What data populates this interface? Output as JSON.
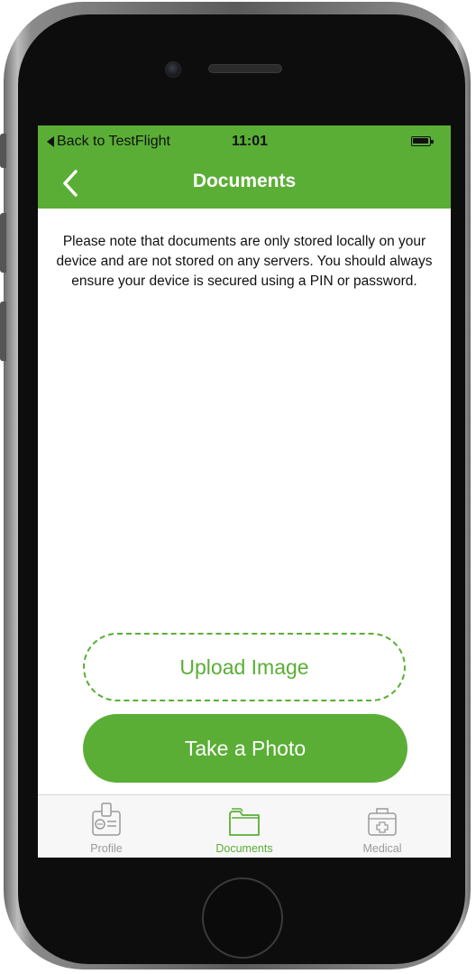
{
  "status_bar": {
    "back_label": "Back to TestFlight",
    "time": "11:01"
  },
  "nav": {
    "title": "Documents",
    "back_icon": "chevron-left-icon"
  },
  "notice": {
    "text": "Please note that documents are only stored locally on your device and are not stored on any servers. You should always ensure your device is secured using a PIN or password."
  },
  "actions": {
    "upload_label": "Upload Image",
    "photo_label": "Take a Photo"
  },
  "tabs": [
    {
      "label": "Profile",
      "icon": "id-badge-icon",
      "active": false
    },
    {
      "label": "Documents",
      "icon": "folder-icon",
      "active": true
    },
    {
      "label": "Medical",
      "icon": "medical-kit-icon",
      "active": false
    }
  ],
  "colors": {
    "accent": "#5aae35",
    "inactive_tab": "#9a9a9a",
    "tab_bar_bg": "#f7f7f7"
  }
}
